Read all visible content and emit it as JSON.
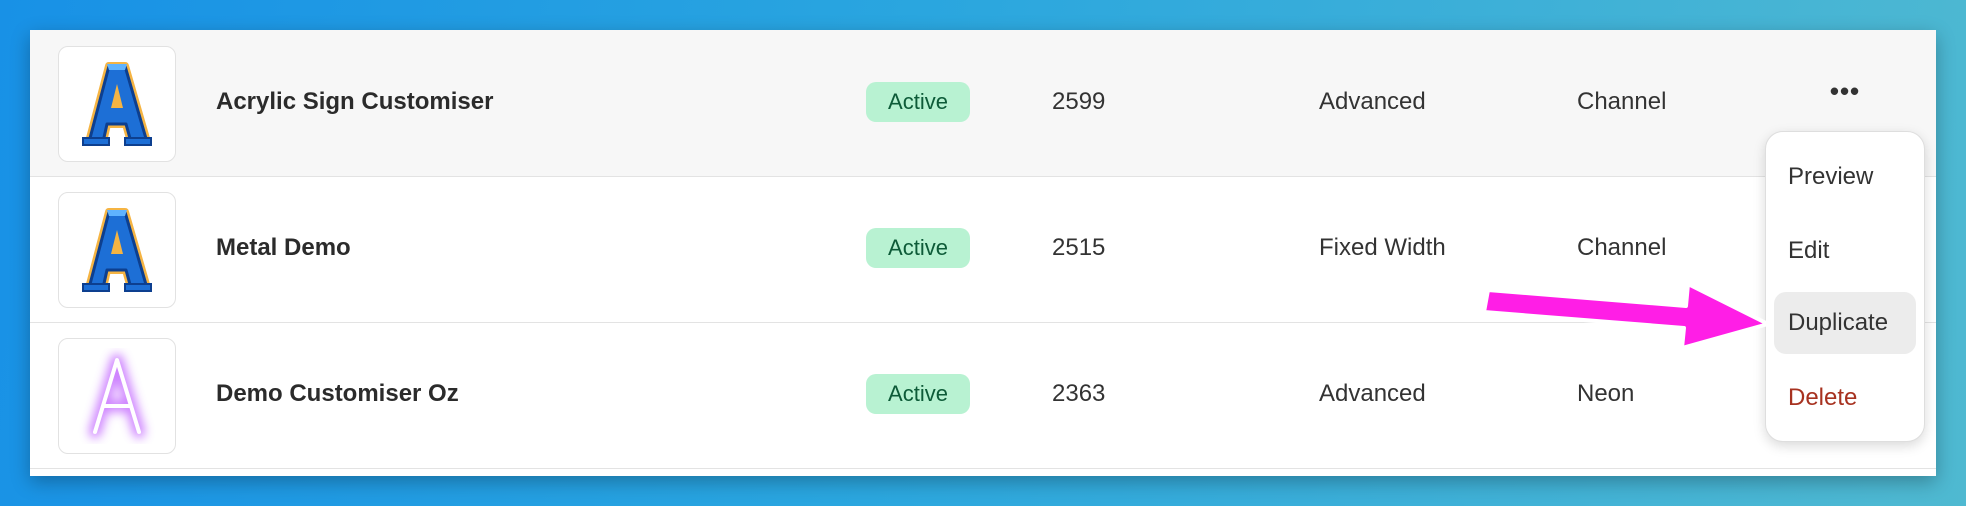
{
  "rows": [
    {
      "name": "Acrylic Sign Customiser",
      "status": "Active",
      "id": "2599",
      "type": "Advanced",
      "category": "Channel",
      "thumbnail_icon": "letter-a-3d-icon"
    },
    {
      "name": "Metal Demo",
      "status": "Active",
      "id": "2515",
      "type": "Fixed Width",
      "category": "Channel",
      "thumbnail_icon": "letter-a-3d-icon"
    },
    {
      "name": "Demo Customiser Oz",
      "status": "Active",
      "id": "2363",
      "type": "Advanced",
      "category": "Neon",
      "thumbnail_icon": "letter-a-neon-icon"
    }
  ],
  "more_button": {
    "label": "•••"
  },
  "menu": {
    "items": [
      {
        "label": "Preview"
      },
      {
        "label": "Edit"
      },
      {
        "label": "Duplicate",
        "highlighted": true
      },
      {
        "label": "Delete",
        "danger": true
      }
    ]
  },
  "colors": {
    "active_badge_bg": "#b8f2d2",
    "active_badge_text": "#0d5b38",
    "delete_text": "#a73220",
    "annotation_arrow": "#ff1ee6",
    "background_gradient_start": "#1891e6",
    "background_gradient_end": "#4fb9d1"
  },
  "annotation": {
    "type": "arrow",
    "points_to": "Duplicate"
  }
}
